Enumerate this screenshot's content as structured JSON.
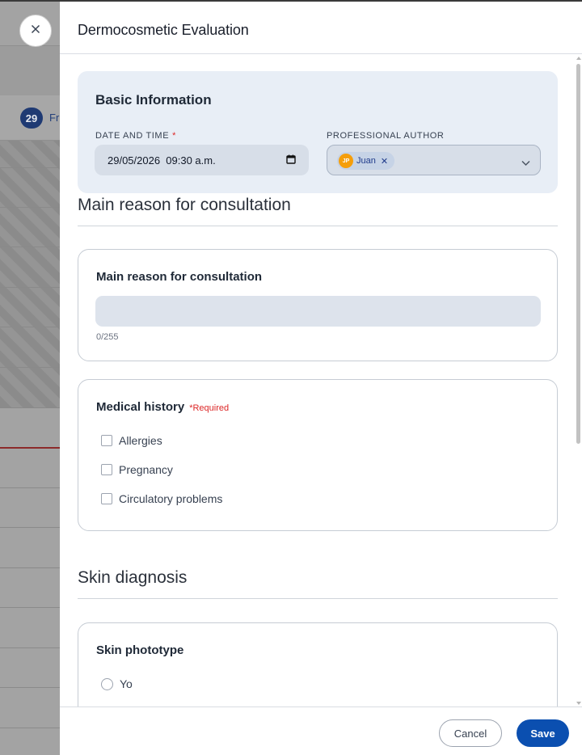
{
  "background": {
    "day_number": "29",
    "day_text": "Fr"
  },
  "modal": {
    "title": "Dermocosmetic Evaluation"
  },
  "basic_info": {
    "title": "Basic Information",
    "date_label": "DATE AND TIME",
    "date_required_mark": "*",
    "date_value": "29/05/2026  09:30 a.m.",
    "author_label": "PROFESSIONAL AUTHOR",
    "author_chip": {
      "initials": "JP",
      "name": "Juan"
    }
  },
  "reason_section": {
    "heading": "Main reason for consultation",
    "card_title": "Main reason for consultation",
    "input_value": "",
    "counter": "0/255"
  },
  "history_card": {
    "title": "Medical history",
    "required": "*Required",
    "options": [
      "Allergies",
      "Pregnancy",
      "Circulatory problems"
    ]
  },
  "skin_section": {
    "heading": "Skin diagnosis",
    "card_title": "Skin phototype",
    "options": [
      "Yo"
    ]
  },
  "footer": {
    "cancel_label": "Cancel",
    "save_label": "Save"
  }
}
